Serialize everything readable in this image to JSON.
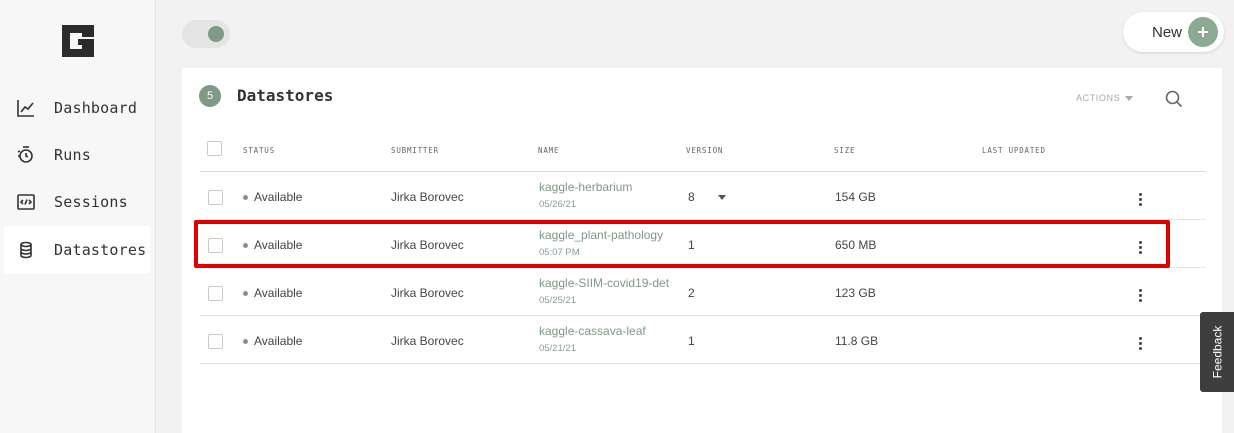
{
  "sidebar": {
    "items": [
      {
        "label": "Dashboard",
        "icon": "chart-line-icon"
      },
      {
        "label": "Runs",
        "icon": "runs-icon"
      },
      {
        "label": "Sessions",
        "icon": "code-window-icon"
      },
      {
        "label": "Datastores",
        "icon": "database-icon",
        "active": true
      }
    ]
  },
  "header": {
    "new_label": "New",
    "toggle_on": true
  },
  "datastores": {
    "count": "5",
    "title": "Datastores",
    "actions_label": "ACTIONS",
    "columns": [
      "STATUS",
      "SUBMITTER",
      "NAME",
      "VERSION",
      "SIZE",
      "LAST UPDATED"
    ],
    "rows": [
      {
        "status": "Available",
        "submitter": "Jirka Borovec",
        "name": "kaggle-herbarium",
        "date": "05/26/21",
        "version": "8",
        "size": "154 GB"
      },
      {
        "status": "Available",
        "submitter": "Jirka Borovec",
        "name": "kaggle_plant-pathology",
        "date": "05:07 PM",
        "version": "1",
        "size": "650 MB"
      },
      {
        "status": "Available",
        "submitter": "Jirka Borovec",
        "name": "kaggle-SIIM-covid19-det",
        "date": "05/25/21",
        "version": "2",
        "size": "123 GB"
      },
      {
        "status": "Available",
        "submitter": "Jirka Borovec",
        "name": "kaggle-cassava-leaf",
        "date": "05/21/21",
        "version": "1",
        "size": "11.8 GB"
      }
    ]
  },
  "feedback_label": "Feedback",
  "colors": {
    "accent": "#7e9986",
    "highlight": "#e00000",
    "sidebar_bg": "#f7f7f7"
  }
}
